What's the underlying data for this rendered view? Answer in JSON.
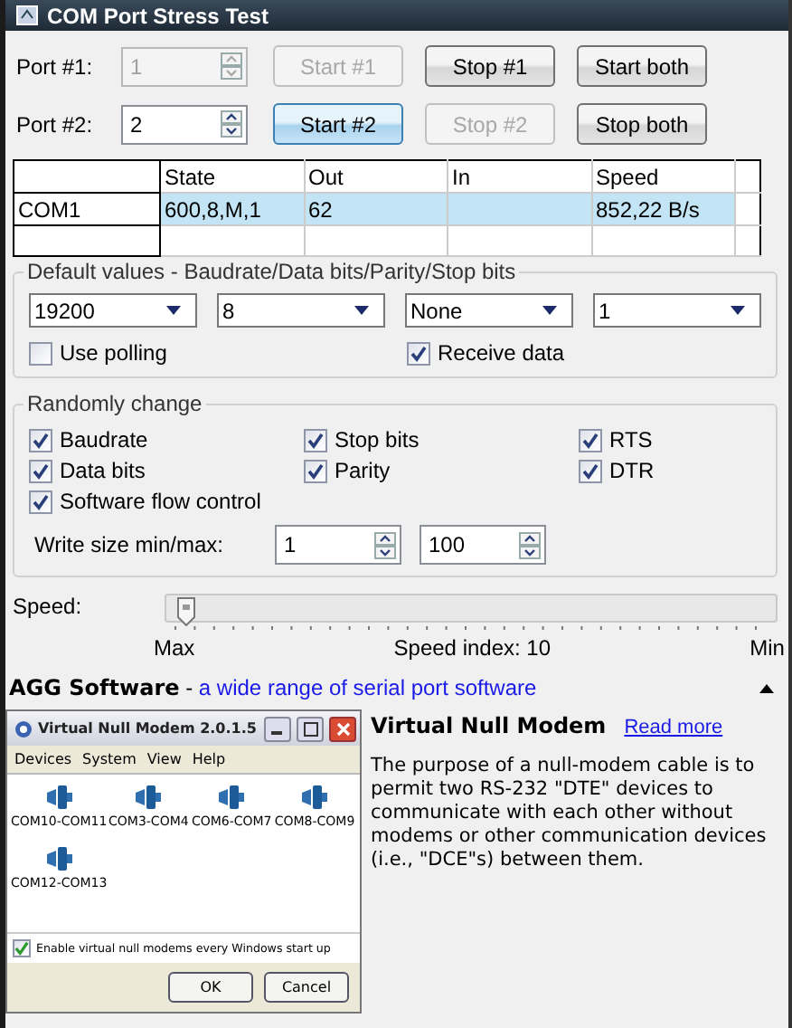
{
  "window": {
    "title": "COM Port Stress Test"
  },
  "ports": [
    {
      "label": "Port #1:",
      "value": "1",
      "disabled": true,
      "buttons": [
        {
          "label": "Start #1",
          "disabled": true,
          "focused": false
        },
        {
          "label": "Stop #1",
          "disabled": false,
          "focused": false
        },
        {
          "label": "Start both",
          "disabled": false,
          "focused": false
        }
      ]
    },
    {
      "label": "Port #2:",
      "value": "2",
      "disabled": false,
      "buttons": [
        {
          "label": "Start #2",
          "disabled": false,
          "focused": true
        },
        {
          "label": "Stop #2",
          "disabled": true,
          "focused": false
        },
        {
          "label": "Stop both",
          "disabled": false,
          "focused": false
        }
      ]
    }
  ],
  "table": {
    "columns": [
      "State",
      "Out",
      "In",
      "Speed"
    ],
    "rows": [
      {
        "port": "COM1",
        "state": "600,8,M,1",
        "out": "62",
        "speed": "852,22 B/s",
        "selected": true
      }
    ]
  },
  "defaults": {
    "title": "Default values - Baudrate/Data bits/Parity/Stop bits",
    "combos": [
      "19200",
      "8",
      "None",
      "1"
    ],
    "checks": [
      {
        "label": "Use polling",
        "checked": false
      },
      {
        "label": "Receive data",
        "checked": true
      }
    ]
  },
  "random": {
    "title": "Randomly change",
    "checks": [
      {
        "label": "Baudrate",
        "checked": true
      },
      {
        "label": "Stop bits",
        "checked": true
      },
      {
        "label": "RTS",
        "checked": true
      },
      {
        "label": "Data bits",
        "checked": true
      },
      {
        "label": "Parity",
        "checked": true
      },
      {
        "label": "DTR",
        "checked": true
      },
      {
        "label": "Software flow control",
        "checked": true
      }
    ],
    "write_size": {
      "label": "Write size min/max:",
      "min": "1",
      "max": "100"
    }
  },
  "speed": {
    "label": "Speed:",
    "level": 0.02,
    "min_label": "Max",
    "index_label": "Speed index: 10",
    "max_label": "Min"
  },
  "promo": {
    "company": "AGG Software",
    "separator": "-",
    "tagline": "a wide range of serial port software",
    "product": "Virtual Null Modem",
    "link": "Read more",
    "description": "The purpose of a null-modem cable is to permit two RS-232 \"DTE\" devices to communicate with each other without modems or other communication devices (i.e., \"DCE\"s) between them.",
    "screenshot": {
      "title": "Virtual Null Modem 2.0.1.5",
      "menu": [
        "Devices",
        "System",
        "View",
        "Help"
      ],
      "items": [
        "COM10-COM11",
        "COM3-COM4",
        "COM6-COM7",
        "COM8-COM9",
        "COM12-COM13"
      ],
      "checkbox": {
        "label": "Enable virtual null modems every Windows start up",
        "checked": true
      },
      "buttons": [
        "OK",
        "Cancel"
      ]
    }
  }
}
